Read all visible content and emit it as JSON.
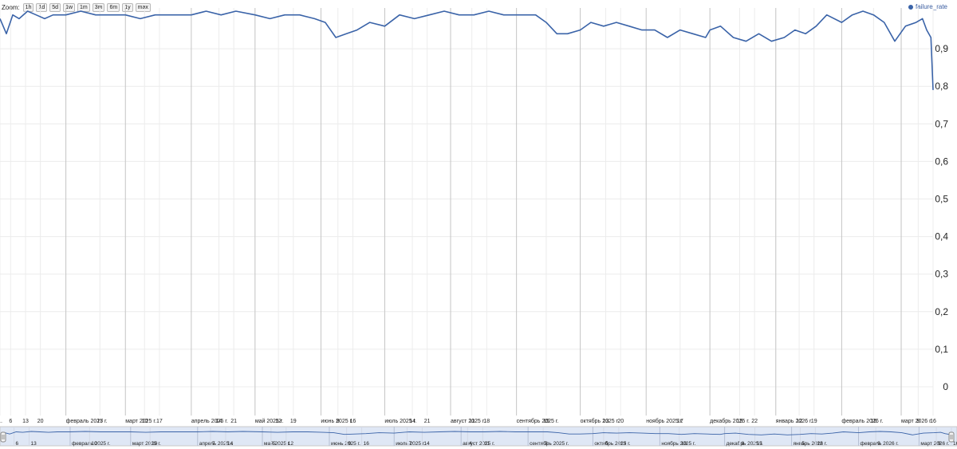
{
  "zoom": {
    "label": "Zoom:",
    "buttons": [
      "1h",
      "1d",
      "5d",
      "1w",
      "1m",
      "3m",
      "6m",
      "1y",
      "max"
    ]
  },
  "colors": {
    "line": "#3a63a8",
    "navigator_fill": "#dfe7f5",
    "grid_major": "#c4c4c4",
    "grid_minor": "#ececec"
  },
  "chart_data": {
    "type": "line",
    "title": "",
    "xlabel": "",
    "ylabel": "",
    "legend": {
      "entries": [
        "failure_rate"
      ],
      "position": "top-right"
    },
    "ylim": [
      0,
      1.0
    ],
    "y_ticks": [
      "0",
      "0,1",
      "0,2",
      "0,3",
      "0,4",
      "0,5",
      "0,6",
      "0,7",
      "0,8",
      "0,9"
    ],
    "xlim": [
      "2025-01-01",
      "2026-03-16"
    ],
    "x_ticks": [
      {
        "x": "2025-01-01",
        "label": "..."
      },
      {
        "x": "2025-01-06",
        "label": "6"
      },
      {
        "x": "2025-01-13",
        "label": "13"
      },
      {
        "x": "2025-01-20",
        "label": "20"
      },
      {
        "x": "2025-02-01",
        "label": "февраль 2025 г."
      },
      {
        "x": "2025-02-17",
        "label": "17"
      },
      {
        "x": "2025-03-01",
        "label": "март 2025 г."
      },
      {
        "x": "2025-03-10",
        "label": "10"
      },
      {
        "x": "2025-03-17",
        "label": "17"
      },
      {
        "x": "2025-04-01",
        "label": "апрель 2025 г."
      },
      {
        "x": "2025-04-14",
        "label": "14"
      },
      {
        "x": "2025-04-21",
        "label": "21"
      },
      {
        "x": "2025-05-01",
        "label": "май 2025 г."
      },
      {
        "x": "2025-05-12",
        "label": "12"
      },
      {
        "x": "2025-05-19",
        "label": "19"
      },
      {
        "x": "2025-06-01",
        "label": "июнь 2025 г."
      },
      {
        "x": "2025-06-09",
        "label": "9"
      },
      {
        "x": "2025-06-16",
        "label": "16"
      },
      {
        "x": "2025-07-01",
        "label": "июль 2025 г."
      },
      {
        "x": "2025-07-14",
        "label": "14"
      },
      {
        "x": "2025-07-21",
        "label": "21"
      },
      {
        "x": "2025-08-01",
        "label": "август 2025 г."
      },
      {
        "x": "2025-08-11",
        "label": "11"
      },
      {
        "x": "2025-08-18",
        "label": "18"
      },
      {
        "x": "2025-09-01",
        "label": "сентябрь 2025 г."
      },
      {
        "x": "2025-09-15",
        "label": "15"
      },
      {
        "x": "2025-10-01",
        "label": "октябрь 2025 г."
      },
      {
        "x": "2025-10-13",
        "label": "13"
      },
      {
        "x": "2025-10-20",
        "label": "20"
      },
      {
        "x": "2025-11-01",
        "label": "ноябрь 2025 г."
      },
      {
        "x": "2025-11-17",
        "label": "17"
      },
      {
        "x": "2025-12-01",
        "label": "декабрь 2025 г."
      },
      {
        "x": "2025-12-15",
        "label": "15"
      },
      {
        "x": "2025-12-22",
        "label": "22"
      },
      {
        "x": "2026-01-01",
        "label": "январь 2026 г."
      },
      {
        "x": "2026-01-12",
        "label": "12"
      },
      {
        "x": "2026-01-19",
        "label": "19"
      },
      {
        "x": "2026-02-01",
        "label": "февраль 2026 г."
      },
      {
        "x": "2026-02-16",
        "label": "16"
      },
      {
        "x": "2026-03-01",
        "label": "март 2026 г."
      },
      {
        "x": "2026-03-09",
        "label": "9"
      },
      {
        "x": "2026-03-16",
        "label": "16"
      }
    ],
    "navigator_ticks": [
      {
        "x": "2025-01-06",
        "label": "6"
      },
      {
        "x": "2025-01-13",
        "label": "13"
      },
      {
        "x": "2025-02-01",
        "label": "февраль 2025 г."
      },
      {
        "x": "2025-02-10",
        "label": "10"
      },
      {
        "x": "2025-03-01",
        "label": "март 2025 г."
      },
      {
        "x": "2025-03-10",
        "label": "10"
      },
      {
        "x": "2025-04-01",
        "label": "апрель 2025 г."
      },
      {
        "x": "2025-04-07",
        "label": "7"
      },
      {
        "x": "2025-04-14",
        "label": "14"
      },
      {
        "x": "2025-05-01",
        "label": "май 2025 г."
      },
      {
        "x": "2025-05-05",
        "label": "5"
      },
      {
        "x": "2025-05-12",
        "label": "12"
      },
      {
        "x": "2025-06-01",
        "label": "июнь 2025 г."
      },
      {
        "x": "2025-06-09",
        "label": "9"
      },
      {
        "x": "2025-06-16",
        "label": "16"
      },
      {
        "x": "2025-07-01",
        "label": "июль 2025 г."
      },
      {
        "x": "2025-07-07",
        "label": "7"
      },
      {
        "x": "2025-07-14",
        "label": "14"
      },
      {
        "x": "2025-08-01",
        "label": "август 2025 г."
      },
      {
        "x": "2025-08-04",
        "label": "4"
      },
      {
        "x": "2025-08-11",
        "label": "11"
      },
      {
        "x": "2025-09-01",
        "label": "сентябрь 2025 г."
      },
      {
        "x": "2025-09-08",
        "label": "8"
      },
      {
        "x": "2025-10-01",
        "label": "октябрь 2025 г."
      },
      {
        "x": "2025-10-06",
        "label": "6"
      },
      {
        "x": "2025-10-13",
        "label": "13"
      },
      {
        "x": "2025-11-01",
        "label": "ноябрь 2025 г."
      },
      {
        "x": "2025-11-10",
        "label": "10"
      },
      {
        "x": "2025-12-01",
        "label": "декабрь 2025 г."
      },
      {
        "x": "2025-12-08",
        "label": "8"
      },
      {
        "x": "2025-12-15",
        "label": "15"
      },
      {
        "x": "2026-01-01",
        "label": "январь 2026 г."
      },
      {
        "x": "2026-01-05",
        "label": "5"
      },
      {
        "x": "2026-01-12",
        "label": "12"
      },
      {
        "x": "2026-02-01",
        "label": "февраль 2026 г."
      },
      {
        "x": "2026-02-09",
        "label": "9"
      },
      {
        "x": "2026-03-01",
        "label": "март 2026 г."
      },
      {
        "x": "2026-03-09",
        "label": "9"
      },
      {
        "x": "2026-03-16",
        "label": "16"
      }
    ],
    "series": [
      {
        "name": "failure_rate",
        "x": [
          "2025-01-01",
          "2025-01-04",
          "2025-01-07",
          "2025-01-10",
          "2025-01-14",
          "2025-01-18",
          "2025-01-22",
          "2025-01-26",
          "2025-02-01",
          "2025-02-08",
          "2025-02-15",
          "2025-02-22",
          "2025-03-01",
          "2025-03-08",
          "2025-03-15",
          "2025-03-22",
          "2025-04-01",
          "2025-04-08",
          "2025-04-15",
          "2025-04-22",
          "2025-05-01",
          "2025-05-08",
          "2025-05-15",
          "2025-05-22",
          "2025-05-29",
          "2025-06-03",
          "2025-06-08",
          "2025-06-13",
          "2025-06-18",
          "2025-06-24",
          "2025-07-01",
          "2025-07-08",
          "2025-07-15",
          "2025-07-22",
          "2025-07-29",
          "2025-08-05",
          "2025-08-12",
          "2025-08-19",
          "2025-08-26",
          "2025-09-01",
          "2025-09-06",
          "2025-09-10",
          "2025-09-15",
          "2025-09-20",
          "2025-09-25",
          "2025-10-01",
          "2025-10-06",
          "2025-10-12",
          "2025-10-18",
          "2025-10-24",
          "2025-10-30",
          "2025-11-05",
          "2025-11-11",
          "2025-11-17",
          "2025-11-23",
          "2025-11-29",
          "2025-12-01",
          "2025-12-06",
          "2025-12-12",
          "2025-12-18",
          "2025-12-24",
          "2025-12-30",
          "2026-01-05",
          "2026-01-10",
          "2026-01-15",
          "2026-01-20",
          "2026-01-25",
          "2026-02-01",
          "2026-02-06",
          "2026-02-11",
          "2026-02-16",
          "2026-02-21",
          "2026-02-26",
          "2026-03-03",
          "2026-03-08",
          "2026-03-11",
          "2026-03-13",
          "2026-03-15",
          "2026-03-16"
        ],
        "values": [
          0.98,
          0.94,
          0.99,
          0.98,
          1.0,
          0.99,
          0.98,
          0.99,
          0.99,
          1.0,
          0.99,
          0.99,
          0.99,
          0.98,
          0.99,
          0.99,
          0.99,
          1.0,
          0.99,
          1.0,
          0.99,
          0.98,
          0.99,
          0.99,
          0.98,
          0.97,
          0.93,
          0.94,
          0.95,
          0.97,
          0.96,
          0.99,
          0.98,
          0.99,
          1.0,
          0.99,
          0.99,
          1.0,
          0.99,
          0.99,
          0.99,
          0.99,
          0.97,
          0.94,
          0.94,
          0.95,
          0.97,
          0.96,
          0.97,
          0.96,
          0.95,
          0.95,
          0.93,
          0.95,
          0.94,
          0.93,
          0.95,
          0.96,
          0.93,
          0.92,
          0.94,
          0.92,
          0.93,
          0.95,
          0.94,
          0.96,
          0.99,
          0.97,
          0.99,
          1.0,
          0.99,
          0.97,
          0.92,
          0.96,
          0.97,
          0.98,
          0.95,
          0.93,
          0.79
        ]
      }
    ]
  }
}
